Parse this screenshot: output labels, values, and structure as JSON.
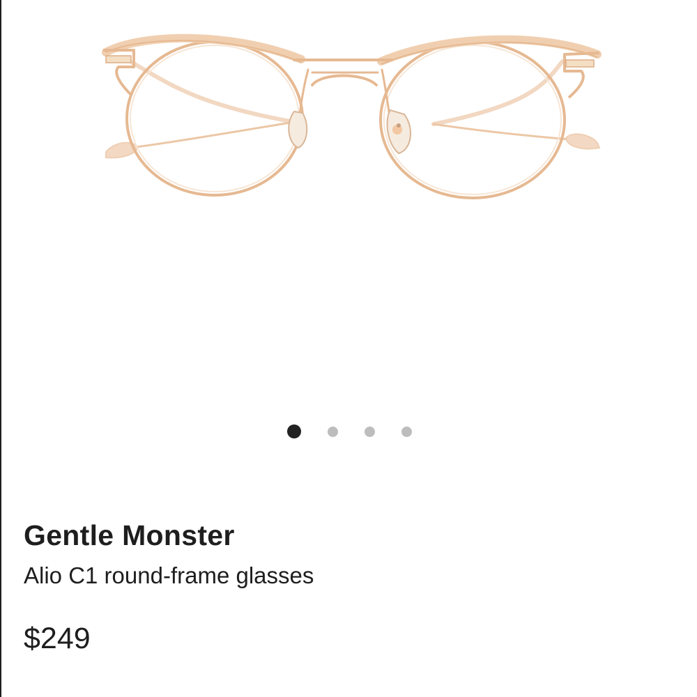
{
  "gallery": {
    "image_alt": "Alio C1 round-frame glasses",
    "slide_count": 4,
    "active_index": 0,
    "colors": {
      "dot_active": "#222222",
      "dot_inactive": "#bdbdbd",
      "frame_metal": "#e6b992",
      "frame_acetate": "#f3d3b6",
      "nose_pad": "#f0ddc8"
    }
  },
  "product": {
    "brand": "Gentle Monster",
    "name": "Alio C1 round-frame glasses",
    "price": "$249"
  }
}
